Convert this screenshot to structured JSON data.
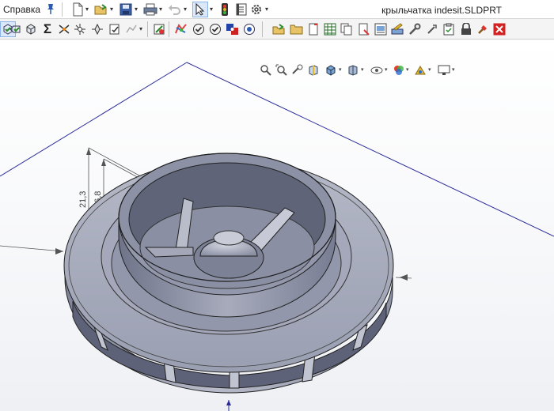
{
  "menu": {
    "help_label": "Справка"
  },
  "document": {
    "filename": "крыльчатка indesit.SLDPRT"
  },
  "dimensions": {
    "dim_outer": "21,3",
    "dim_inner": "16,8"
  },
  "icons": {
    "title_toolbar": [
      "pin-icon",
      "new-document-icon",
      "open-icon",
      "save-icon",
      "print-icon",
      "undo-icon",
      "select-icon",
      "rebuild-traffic-light-icon",
      "file-properties-icon",
      "options-gear-icon"
    ],
    "toolbar2": [
      "box-select-icon",
      "smart-dimension-icon",
      "part-icon",
      "sum-icon",
      "measure-icon",
      "mass-properties-icon",
      "section-icon",
      "check-icon",
      "stats-icon",
      "simulation-icon",
      "color-icon",
      "checkmark-icon",
      "design-checker-icon",
      "hole-icon",
      "export-icon",
      "open-folder-icon",
      "close-file-icon",
      "table-icon",
      "copy-icon",
      "rename-icon",
      "print-preview-icon",
      "pencil-icon",
      "tools-icon",
      "clipboard-icon",
      "lock-icon",
      "paint-icon",
      "close-red-icon"
    ],
    "heads_up": [
      "zoom-to-fit-icon",
      "zoom-area-icon",
      "previous-view-icon",
      "section-view-icon",
      "view-orientation-icon",
      "display-style-icon",
      "hide-show-icon",
      "edit-appearance-icon",
      "apply-scene-icon",
      "view-settings-icon"
    ]
  },
  "colors": {
    "accent_blue": "#1f5fbf",
    "axis_line": "#2b2b9a",
    "model_fill": "#a8adbf",
    "model_shade": "#7d8297",
    "close_red": "#d42020"
  }
}
